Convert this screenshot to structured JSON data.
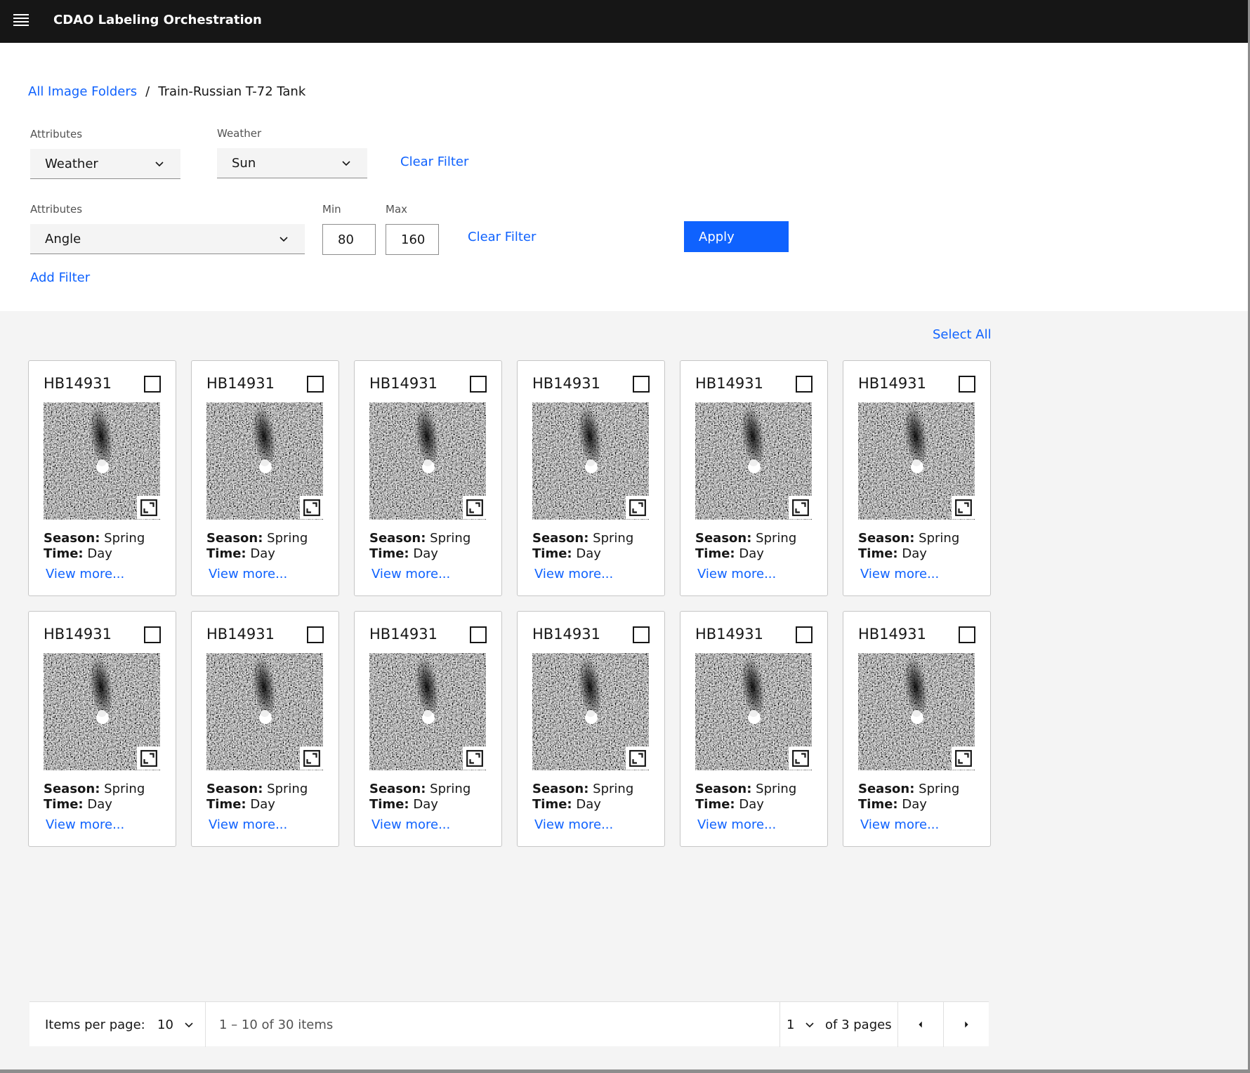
{
  "header": {
    "title": "CDAO Labeling Orchestration"
  },
  "breadcrumb": {
    "root": "All Image Folders",
    "separator": "/",
    "current": "Train-Russian T-72 Tank"
  },
  "filter1": {
    "attr_label": "Attributes",
    "attr_value": "Weather",
    "value_label": "Weather",
    "value": "Sun",
    "clear": "Clear Filter"
  },
  "filter2": {
    "attr_label": "Attributes",
    "attr_value": "Angle",
    "min_label": "Min",
    "min": "80",
    "max_label": "Max",
    "max": "160",
    "clear": "Clear Filter"
  },
  "apply": "Apply",
  "add_filter": "Add Filter",
  "select_all": "Select All",
  "cards": [
    {
      "id": "HB14931",
      "season_label": "Season:",
      "season": "Spring",
      "time_label": "Time:",
      "time": "Day",
      "link": "View more..."
    },
    {
      "id": "HB14931",
      "season_label": "Season:",
      "season": "Spring",
      "time_label": "Time:",
      "time": "Day",
      "link": "View more..."
    },
    {
      "id": "HB14931",
      "season_label": "Season:",
      "season": "Spring",
      "time_label": "Time:",
      "time": "Day",
      "link": "View more..."
    },
    {
      "id": "HB14931",
      "season_label": "Season:",
      "season": "Spring",
      "time_label": "Time:",
      "time": "Day",
      "link": "View more..."
    },
    {
      "id": "HB14931",
      "season_label": "Season:",
      "season": "Spring",
      "time_label": "Time:",
      "time": "Day",
      "link": "View more..."
    },
    {
      "id": "HB14931",
      "season_label": "Season:",
      "season": "Spring",
      "time_label": "Time:",
      "time": "Day",
      "link": "View more..."
    },
    {
      "id": "HB14931",
      "season_label": "Season:",
      "season": "Spring",
      "time_label": "Time:",
      "time": "Day",
      "link": "View more..."
    },
    {
      "id": "HB14931",
      "season_label": "Season:",
      "season": "Spring",
      "time_label": "Time:",
      "time": "Day",
      "link": "View more..."
    },
    {
      "id": "HB14931",
      "season_label": "Season:",
      "season": "Spring",
      "time_label": "Time:",
      "time": "Day",
      "link": "View more..."
    },
    {
      "id": "HB14931",
      "season_label": "Season:",
      "season": "Spring",
      "time_label": "Time:",
      "time": "Day",
      "link": "View more..."
    },
    {
      "id": "HB14931",
      "season_label": "Season:",
      "season": "Spring",
      "time_label": "Time:",
      "time": "Day",
      "link": "View more..."
    },
    {
      "id": "HB14931",
      "season_label": "Season:",
      "season": "Spring",
      "time_label": "Time:",
      "time": "Day",
      "link": "View more..."
    }
  ],
  "pagination": {
    "items_per_page_label": "Items per page:",
    "items_per_page": "10",
    "range": "1 – 10 of 30 items",
    "page": "1",
    "of_pages": "of 3 pages"
  },
  "colors": {
    "accent": "#0f62fe",
    "header_bg": "#161616",
    "grid_bg": "#f4f4f4"
  }
}
